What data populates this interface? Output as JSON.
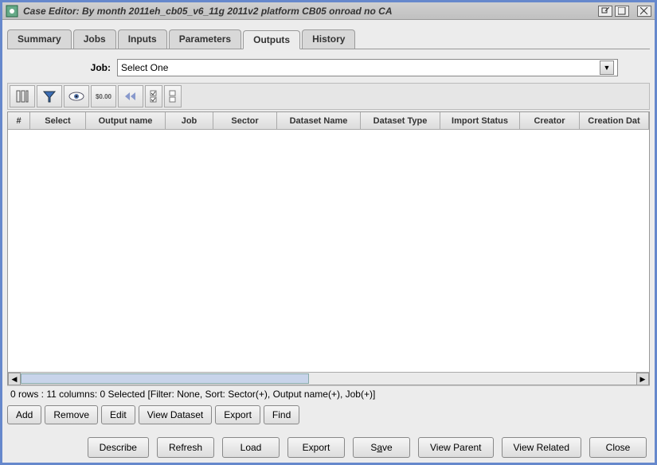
{
  "window": {
    "title": "Case Editor: By month 2011eh_cb05_v6_11g 2011v2 platform CB05 onroad no CA"
  },
  "tabs": {
    "items": [
      "Summary",
      "Jobs",
      "Inputs",
      "Parameters",
      "Outputs",
      "History"
    ],
    "active": "Outputs"
  },
  "job": {
    "label": "Job:",
    "selected": "Select One"
  },
  "toolbar": {
    "icons": [
      "columns-icon",
      "filter-icon",
      "eye-icon",
      "format-icon",
      "rewind-icon",
      "checks-icon",
      "unchecks-icon"
    ]
  },
  "table": {
    "columns": [
      "#",
      "Select",
      "Output name",
      "Job",
      "Sector",
      "Dataset Name",
      "Dataset Type",
      "Import Status",
      "Creator",
      "Creation Dat"
    ]
  },
  "status": "0 rows : 11 columns: 0 Selected [Filter: None, Sort: Sector(+), Output name(+), Job(+)]",
  "row_buttons": {
    "add": "Add",
    "remove": "Remove",
    "edit": "Edit",
    "view_dataset": "View Dataset",
    "export": "Export",
    "find": "Find"
  },
  "bottom_buttons": {
    "describe": "Describe",
    "refresh": "Refresh",
    "load": "Load",
    "export": "Export",
    "save_pre": "S",
    "save_u": "a",
    "save_post": "ve",
    "view_parent": "View Parent",
    "view_related": "View Related",
    "close": "Close"
  }
}
